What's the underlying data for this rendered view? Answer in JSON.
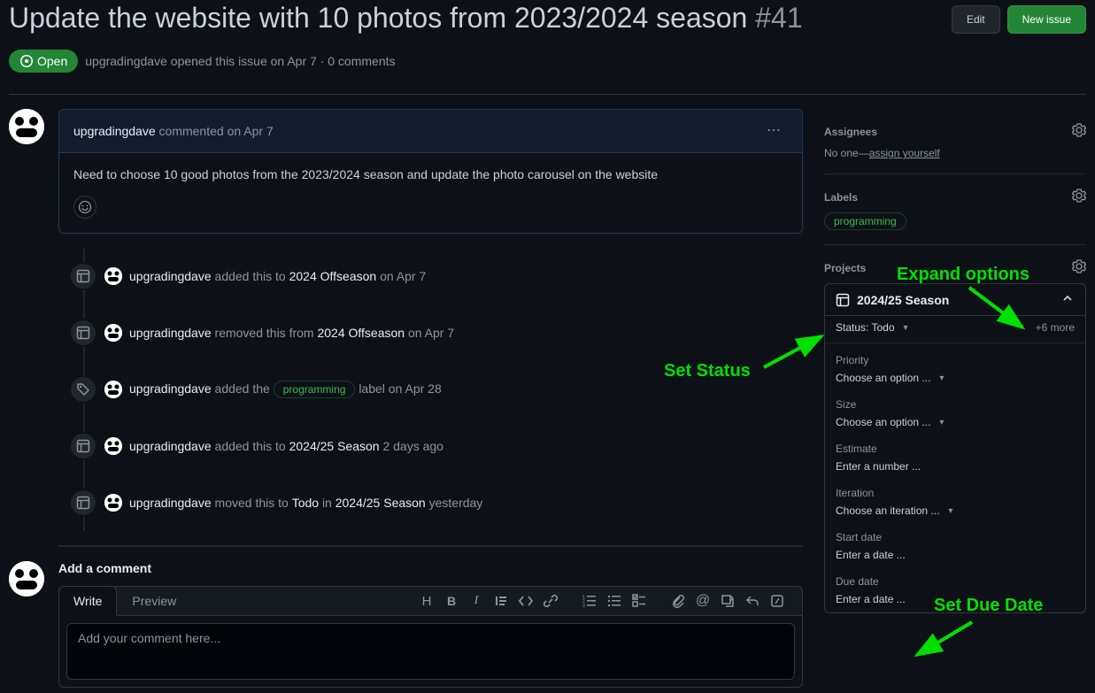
{
  "header": {
    "title": "Update the website with 10 photos from 2023/2024 season",
    "issue_number": "#41",
    "edit_btn": "Edit",
    "new_issue_btn": "New issue",
    "state": "Open",
    "author": "upgradingdave",
    "opened_prefix": "opened this issue",
    "opened_date": "on Apr 7",
    "comments_count": "0 comments"
  },
  "comment": {
    "author": "upgradingdave",
    "verb": "commented",
    "date": "on Apr 7",
    "body": "Need to choose 10 good photos from the 2023/2024 season and update the photo carousel on the website"
  },
  "events": [
    {
      "icon": "table",
      "author": "upgradingdave",
      "text1": "added this to",
      "target": "2024 Offseason",
      "text2": "",
      "date": "on Apr 7"
    },
    {
      "icon": "table",
      "author": "upgradingdave",
      "text1": "removed this from",
      "target": "2024 Offseason",
      "text2": "",
      "date": "on Apr 7"
    },
    {
      "icon": "tag",
      "author": "upgradingdave",
      "text1": "added the",
      "label": "programming",
      "text2": "label",
      "date": "on Apr 28"
    },
    {
      "icon": "table",
      "author": "upgradingdave",
      "text1": "added this to",
      "target": "2024/25 Season",
      "text2": "",
      "date": "2 days ago"
    },
    {
      "icon": "table",
      "author": "upgradingdave",
      "text1": "moved this to",
      "target": "Todo",
      "text2": "in",
      "target2": "2024/25 Season",
      "date": "yesterday"
    }
  ],
  "add_comment": {
    "title": "Add a comment",
    "write_tab": "Write",
    "preview_tab": "Preview",
    "placeholder": "Add your comment here..."
  },
  "sidebar": {
    "assignees": {
      "title": "Assignees",
      "none": "No one—",
      "assign": "assign yourself"
    },
    "labels": {
      "title": "Labels",
      "items": [
        "programming"
      ]
    },
    "projects": {
      "title": "Projects",
      "project_name": "2024/25 Season",
      "status_label": "Status: Todo",
      "more": "+6 more",
      "fields": [
        {
          "label": "Priority",
          "value": "Choose an option ...",
          "type": "select"
        },
        {
          "label": "Size",
          "value": "Choose an option ...",
          "type": "select"
        },
        {
          "label": "Estimate",
          "value": "Enter a number ...",
          "type": "text"
        },
        {
          "label": "Iteration",
          "value": "Choose an iteration ...",
          "type": "select"
        },
        {
          "label": "Start date",
          "value": "Enter a date ...",
          "type": "text"
        },
        {
          "label": "Due date",
          "value": "Enter a date ...",
          "type": "text"
        }
      ]
    }
  },
  "annotations": {
    "expand": "Expand options",
    "set_status": "Set Status",
    "set_due": "Set Due Date"
  }
}
